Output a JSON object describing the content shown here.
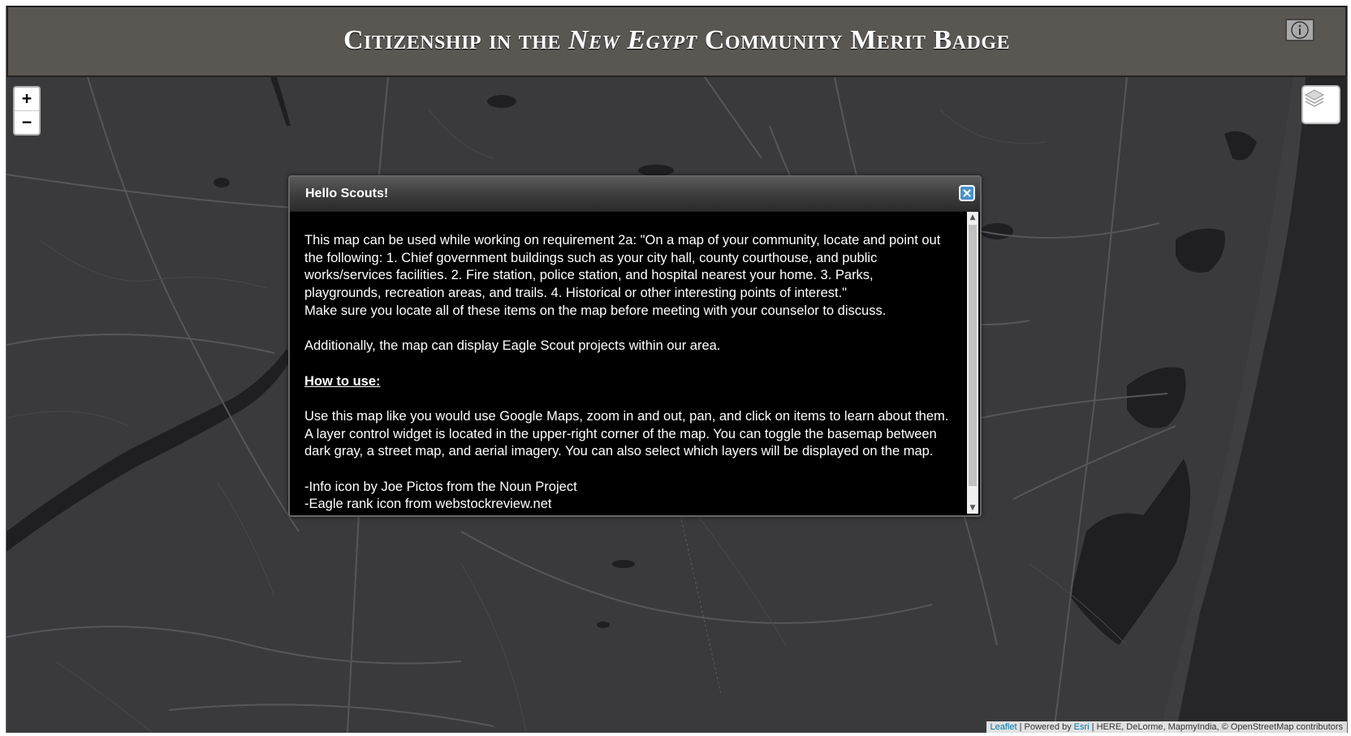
{
  "header": {
    "title_part1": "Citizenship in the ",
    "title_em": "New Egypt",
    "title_part2": " Community Merit Badge",
    "info_icon": "info-icon"
  },
  "map": {
    "zoom_in_label": "+",
    "zoom_out_label": "−",
    "layers_icon": "layers-icon",
    "colors": {
      "land": "#3a3a3c",
      "water": "#202022",
      "roads": "#555558",
      "ocean": "#262628"
    },
    "attribution": {
      "leaflet": "Leaflet",
      "sep1": " | Powered by ",
      "esri": "Esri",
      "rest": " | HERE, DeLorme, MapmyIndia, © OpenStreetMap contributors"
    }
  },
  "modal": {
    "title": "Hello Scouts!",
    "close_icon": "close-icon",
    "paragraph1": "This map can be used while working on requirement 2a: \"On a map of your community, locate and point out the following: 1. Chief government buildings such as your city hall, county courthouse, and public works/services facilities. 2. Fire station, police station, and hospital nearest your home. 3. Parks, playgrounds, recreation areas, and trails. 4. Historical or other interesting points of interest.\"",
    "paragraph2": "Make sure you locate all of these items on the map before meeting with your counselor to discuss.",
    "paragraph3": "Additionally, the map can display Eagle Scout projects within our area.",
    "how_to_heading": "How to use:",
    "paragraph4": "Use this map like you would use Google Maps, zoom in and out, pan, and click on items to learn about them. A layer control widget is located in the upper-right corner of the map. You can toggle the basemap between dark gray, a street map, and aerial imagery. You can also select which layers will be displayed on the map.",
    "credit1": "-Info icon by Joe Pictos from the Noun Project",
    "credit2": "-Eagle rank icon from webstockreview.net"
  }
}
